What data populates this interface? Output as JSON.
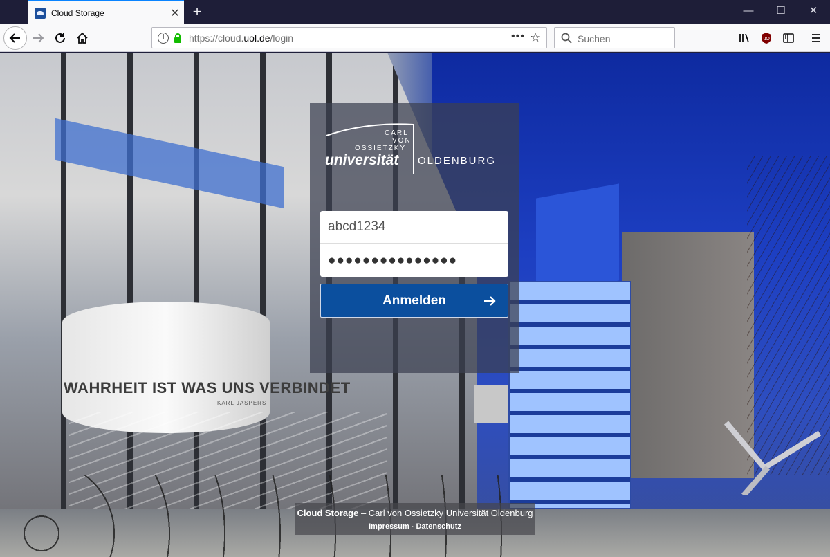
{
  "browser": {
    "tab": {
      "title": "Cloud Storage",
      "close": "✕"
    },
    "new_tab": "+",
    "window": {
      "minimize": "—",
      "maximize": "☐",
      "close": "✕"
    },
    "url": {
      "prefix": "https://cloud.",
      "host": "uol.de",
      "path": "/login"
    },
    "page_actions": "•••",
    "bookmark_star": "☆",
    "search": {
      "placeholder": "Suchen"
    },
    "toolbar_icons": [
      "library-icon",
      "ublock-icon",
      "sidebar-icon",
      "menu-icon"
    ],
    "accent": "#0a84ff"
  },
  "page": {
    "logo": {
      "line1": "CARL",
      "line2": "VON",
      "line3": "OSSIETZKY",
      "word1": "universität",
      "word2": "OLDENBURG"
    },
    "background": {
      "wall_text": "WAHRHEIT IST WAS UNS VERBINDET",
      "wall_sub": "KARL JASPERS"
    },
    "login": {
      "username_value": "abcd1234",
      "password_value": "●●●●●●●●●●●●●●●",
      "button_label": "Anmelden",
      "button_color": "#0b4f9e"
    },
    "footer": {
      "title": "Cloud Storage",
      "separator": " – ",
      "subtitle": "Carl von Ossietzky Universität Oldenburg",
      "link_imprint": "Impressum",
      "dot": "·",
      "link_privacy": "Datenschutz"
    }
  }
}
